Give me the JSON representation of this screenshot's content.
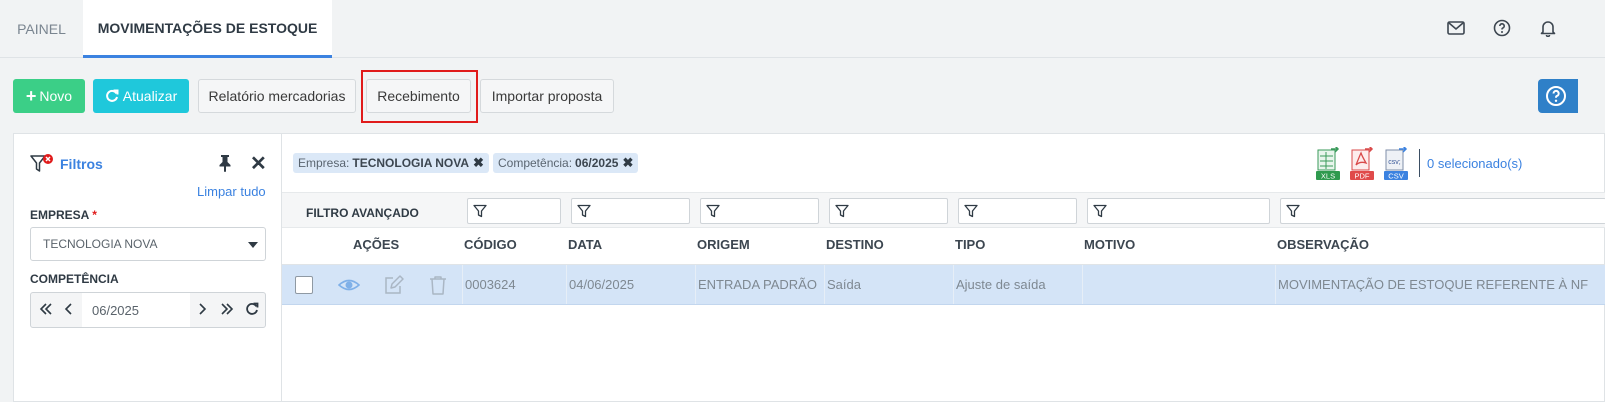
{
  "tabs": [
    {
      "label": "PAINEL",
      "active": false
    },
    {
      "label": "MOVIMENTAÇÕES DE ESTOQUE",
      "active": true
    }
  ],
  "top_icons": [
    "mail-icon",
    "help-circle-icon",
    "bell-icon"
  ],
  "toolbar": {
    "novo": "Novo",
    "atualizar": "Atualizar",
    "relatorio": "Relatório mercadorias",
    "recebimento": "Recebimento",
    "importar": "Importar proposta"
  },
  "filters": {
    "title": "Filtros",
    "clear": "Limpar tudo",
    "empresa_label": "EMPRESA",
    "empresa_required": "*",
    "empresa_value": "TECNOLOGIA NOVA",
    "competencia_label": "COMPETÊNCIA",
    "competencia_value": "06/2025"
  },
  "chips": [
    {
      "label": "Empresa:",
      "value": "TECNOLOGIA NOVA"
    },
    {
      "label": "Competência:",
      "value": "06/2025"
    }
  ],
  "export": {
    "xls": "XLS",
    "pdf": "PDF",
    "csv_top": "csv;",
    "csv": "CSV"
  },
  "selected_count": "0 selecionado(s)",
  "advanced_filter": "FILTRO AVANÇADO",
  "columns": [
    "AÇÕES",
    "CÓDIGO",
    "DATA",
    "ORIGEM",
    "DESTINO",
    "TIPO",
    "MOTIVO",
    "OBSERVAÇÃO"
  ],
  "rows": [
    {
      "codigo": "0003624",
      "data": "04/06/2025",
      "origem": "ENTRADA PADRÃO",
      "destino": "Saída",
      "tipo": "Ajuste de saída",
      "motivo": "",
      "observacao": "MOVIMENTAÇÃO DE ESTOQUE REFERENTE À NF"
    }
  ],
  "colors": {
    "accent": "#3b82e0",
    "novo": "#3bcf87",
    "atualizar": "#1fc8db",
    "highlight": "#e01b1b",
    "row_selected": "#d4e4f7"
  }
}
